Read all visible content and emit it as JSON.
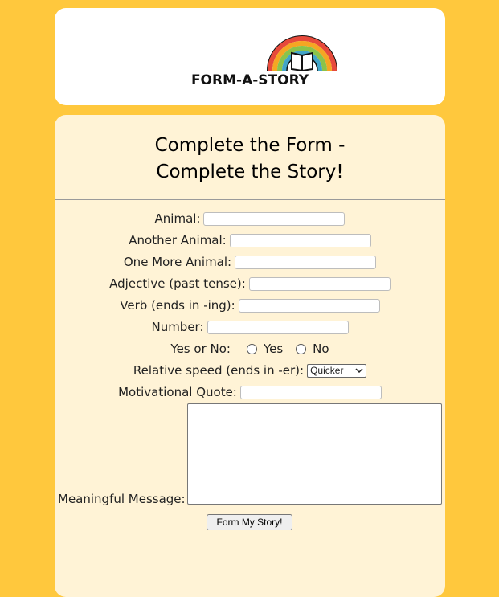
{
  "logo": {
    "text": "FORM-A-STORY",
    "icon": "rainbow-book-icon"
  },
  "heading": {
    "line1": "Complete the Form -",
    "line2": "Complete the Story!"
  },
  "fields": {
    "animal": {
      "label": "Animal:",
      "value": "",
      "placeholder": ""
    },
    "another_animal": {
      "label": "Another Animal:",
      "value": "",
      "placeholder": ""
    },
    "one_more_animal": {
      "label": "One More Animal:",
      "value": "",
      "placeholder": ""
    },
    "adjective": {
      "label": "Adjective (past tense):",
      "value": "",
      "placeholder": ""
    },
    "verb": {
      "label": "Verb (ends in -ing):",
      "value": "",
      "placeholder": ""
    },
    "number": {
      "label": "Number:",
      "value": "",
      "placeholder": ""
    },
    "yes_no": {
      "label": "Yes or No:",
      "option_yes": "Yes",
      "option_no": "No"
    },
    "relative_speed": {
      "label": "Relative speed (ends in -er):",
      "selected": "Quicker"
    },
    "motivational_quote": {
      "label": "Motivational Quote:",
      "value": "",
      "placeholder": ""
    },
    "meaningful_message": {
      "label": "Meaningful Message:",
      "value": ""
    }
  },
  "submit_label": "Form My Story!",
  "colors": {
    "background": "#ffc83d",
    "card": "#fff3d6",
    "header_card": "#ffffff"
  }
}
